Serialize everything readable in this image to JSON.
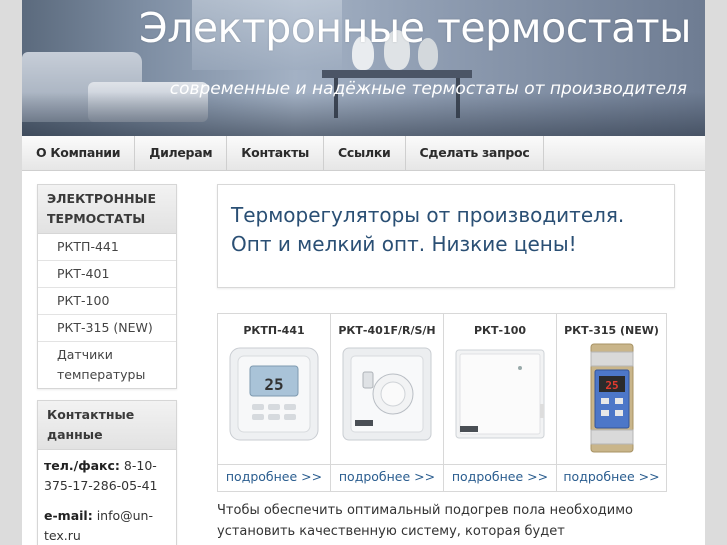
{
  "header": {
    "title": "Электронные термостаты",
    "subtitle": "современные и надёжные термостаты от производителя"
  },
  "nav": {
    "items": [
      {
        "label": "О Компании"
      },
      {
        "label": "Дилерам"
      },
      {
        "label": "Контакты"
      },
      {
        "label": "Ссылки"
      },
      {
        "label": "Сделать запрос"
      }
    ]
  },
  "sidebar": {
    "catalog": {
      "title": "ЭЛЕКТРОННЫЕ ТЕРМОСТАТЫ",
      "items": [
        {
          "label": "РКТП-441"
        },
        {
          "label": "РКТ-401"
        },
        {
          "label": "РКТ-100"
        },
        {
          "label": "РКТ-315 (NEW)"
        },
        {
          "label": "Датчики температуры"
        }
      ]
    },
    "contacts": {
      "title": "Контактные данные",
      "phone_label": "тел./факс:",
      "phone_value": "8-10-375-17-286-05-41",
      "email_label": "e-mail:",
      "email_value": "info@un-tex.ru"
    }
  },
  "main": {
    "intro": "Терморегуляторы от производителя. Опт и мелкий опт. Низкие цены!",
    "products": [
      {
        "name": "РКТП-441",
        "more": "подробнее >>",
        "display": "25"
      },
      {
        "name": "РКТ-401F/R/S/H",
        "more": "подробнее >>",
        "display": ""
      },
      {
        "name": "РКТ-100",
        "more": "подробнее >>",
        "display": ""
      },
      {
        "name": "РКТ-315 (NEW)",
        "more": "подробнее >>",
        "display": "25"
      }
    ],
    "body": "Чтобы обеспечить оптимальный подогрев пола необходимо установить качественную систему, которая будет соответствовать"
  }
}
